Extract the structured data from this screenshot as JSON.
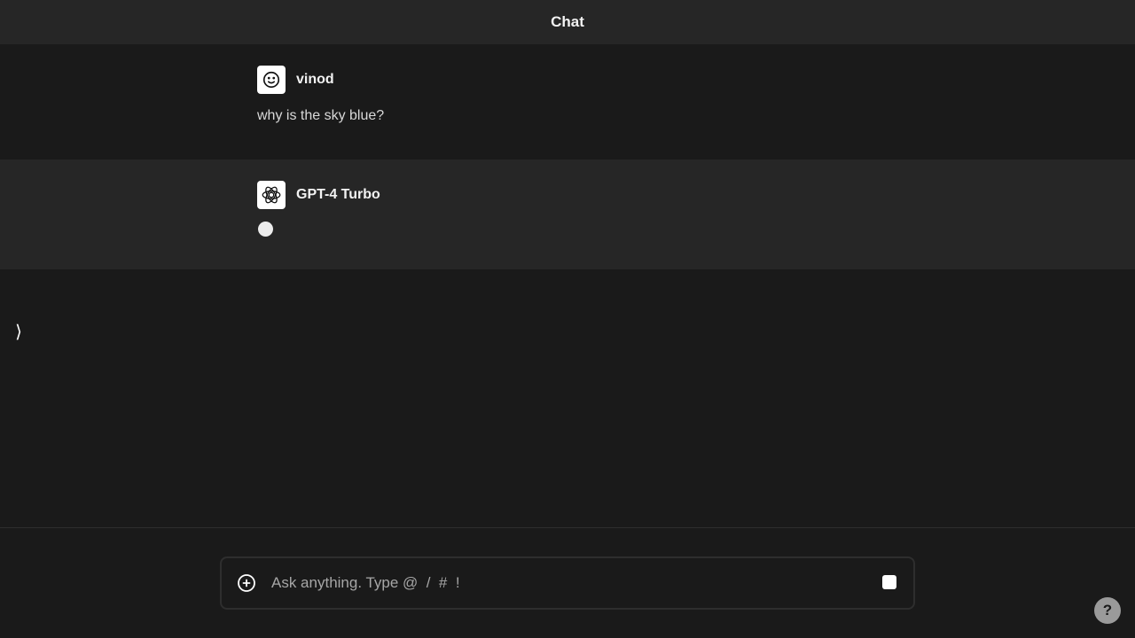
{
  "header": {
    "title": "Chat"
  },
  "messages": [
    {
      "role": "user",
      "author": "vinod",
      "avatar_icon": "smiley-face-icon",
      "text": "why is the sky blue?"
    },
    {
      "role": "assistant",
      "author": "GPT-4 Turbo",
      "avatar_icon": "openai-logo-icon",
      "status": "generating"
    }
  ],
  "sidebar": {
    "toggle_label": "⟩"
  },
  "composer": {
    "placeholder": "Ask anything. Type @  /  #  !",
    "value": "",
    "attach_icon": "plus-circle-icon",
    "stop_icon": "stop-square-icon"
  },
  "help": {
    "label": "?"
  },
  "colors": {
    "background": "#1a1a1a",
    "header_background": "#262626",
    "assistant_row_background": "#262626",
    "text_primary": "#f2f2f2",
    "text_secondary": "#d9d9d9",
    "placeholder": "#a6a6a6",
    "help_button": "#9a9a9a"
  }
}
